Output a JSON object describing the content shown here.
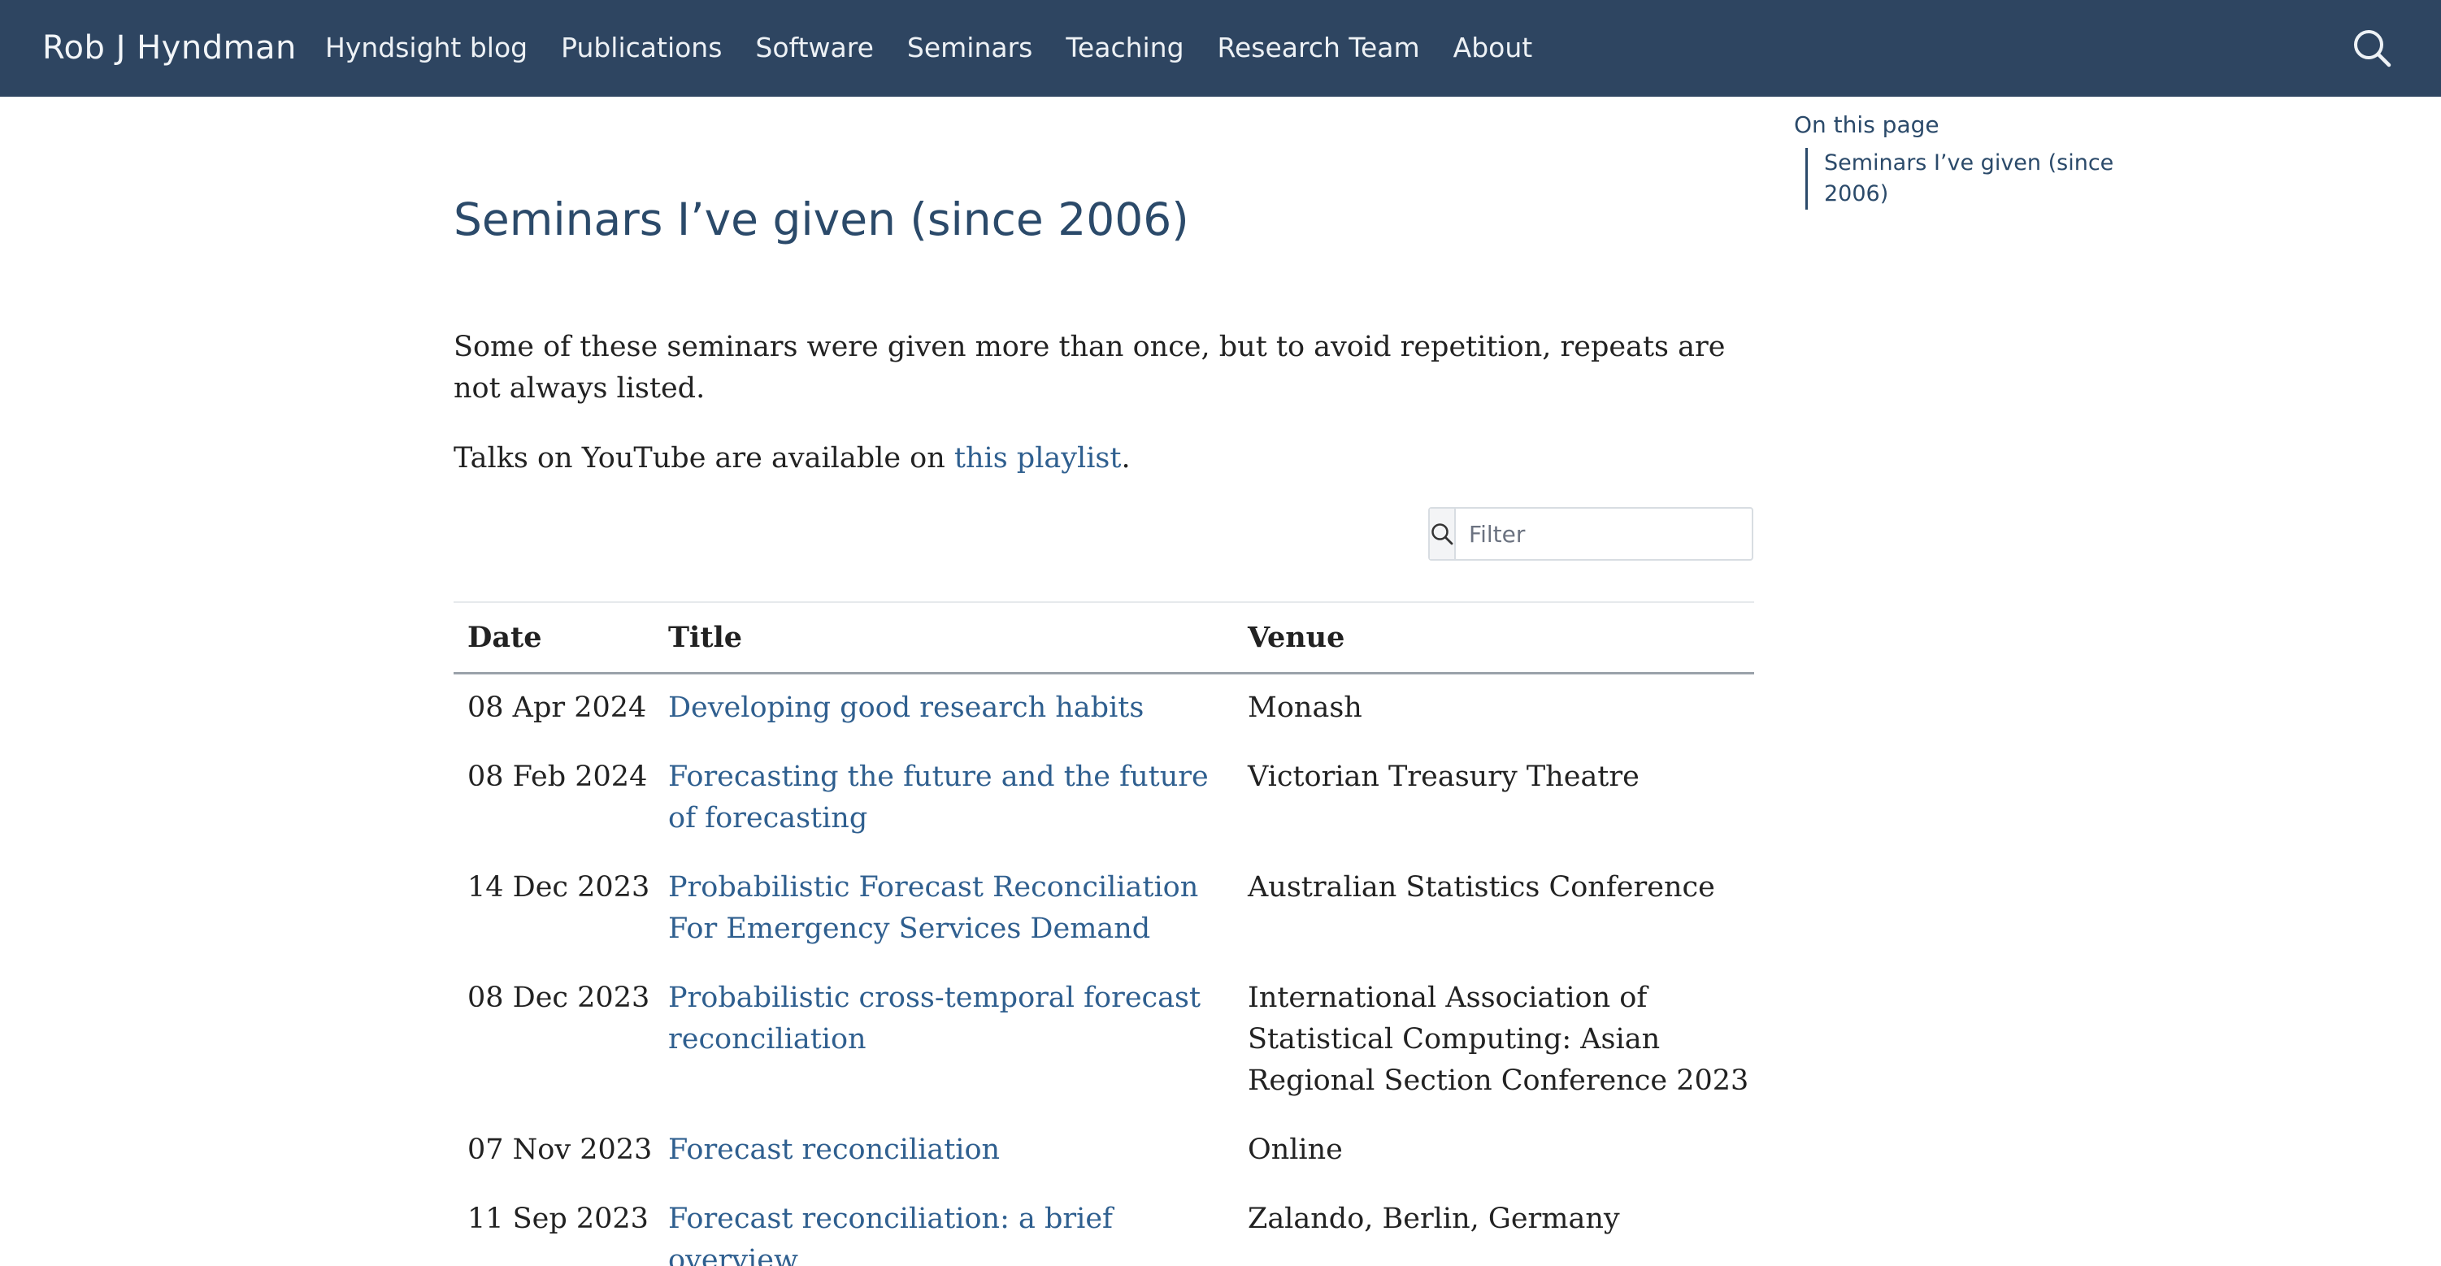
{
  "navbar": {
    "brand": "Rob J Hyndman",
    "links": [
      "Hyndsight blog",
      "Publications",
      "Software",
      "Seminars",
      "Teaching",
      "Research Team",
      "About"
    ],
    "search_icon": "search-icon"
  },
  "toc": {
    "title": "On this page",
    "items": [
      "Seminars I’ve given (since 2006)"
    ]
  },
  "page": {
    "title": "Seminars I’ve given (since 2006)",
    "intro": "Some of these seminars were given more than once, but to avoid repetition, repeats are not always listed.",
    "talks_prefix": "Talks on YouTube are available on ",
    "talks_link": "this playlist",
    "talks_suffix": "."
  },
  "filter": {
    "placeholder": "Filter",
    "icon": "search-icon"
  },
  "table": {
    "headers": [
      "Date",
      "Title",
      "Venue"
    ],
    "rows": [
      {
        "date": "08 Apr 2024",
        "title": "Developing good research habits",
        "venue": "Monash"
      },
      {
        "date": "08 Feb 2024",
        "title": "Forecasting the future and the future of forecasting",
        "venue": "Victorian Treasury Theatre"
      },
      {
        "date": "14 Dec 2023",
        "title": "Probabilistic Forecast Reconciliation For Emergency Services Demand",
        "venue": "Australian Statistics Conference"
      },
      {
        "date": "08 Dec 2023",
        "title": "Probabilistic cross-temporal forecast reconciliation",
        "venue": "International Association of Statistical Computing: Asian Regional Section Conference 2023"
      },
      {
        "date": "07 Nov 2023",
        "title": "Forecast reconciliation",
        "venue": "Online"
      },
      {
        "date": "11 Sep 2023",
        "title": "Forecast reconciliation: a brief overview",
        "venue": "Zalando, Berlin, Germany"
      }
    ]
  },
  "colors": {
    "navbar_bg": "#2e4561",
    "link": "#2f5f8f",
    "heading": "#2b4a6a"
  }
}
